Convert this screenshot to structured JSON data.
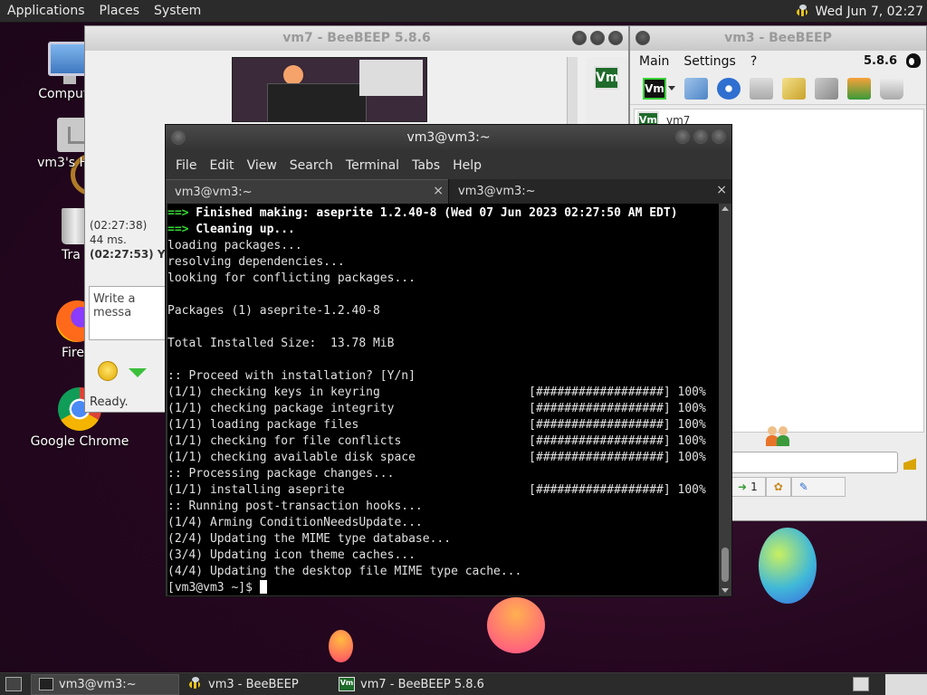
{
  "top_panel": {
    "menus": [
      "Applications",
      "Places",
      "System"
    ],
    "clock": "Wed Jun  7, 02:27"
  },
  "desktop_icons": [
    {
      "label": "Computer"
    },
    {
      "label": "vm3's Home"
    },
    {
      "label": "Tra"
    },
    {
      "label": "Fire"
    },
    {
      "label": "Google Chrome"
    }
  ],
  "beebeep_vm7": {
    "title": "vm7 - BeeBEEP 5.8.6",
    "chat_lines": [
      "(02:27:38)",
      "44 ms.",
      "(02:27:53) You"
    ],
    "input_placeholder": "Write a messa",
    "status": "Ready."
  },
  "beebeep_vm3": {
    "title": "vm3 - BeeBEEP",
    "menus": [
      "Main",
      "Settings",
      "?"
    ],
    "version": "5.8.6",
    "logo_text": "Vm",
    "user": "vm7",
    "bottom_count": "1"
  },
  "terminal": {
    "title": "vm3@vm3:~",
    "menus": [
      "File",
      "Edit",
      "View",
      "Search",
      "Terminal",
      "Tabs",
      "Help"
    ],
    "tabs": [
      {
        "label": "vm3@vm3:~",
        "close": "×"
      },
      {
        "label": "vm3@vm3:~",
        "close": "×"
      }
    ],
    "lines": [
      {
        "prefix": "==>",
        "text": " Finished making: aseprite 1.2.40-8 (Wed 07 Jun 2023 02:27:50 AM EDT)",
        "style": "bold"
      },
      {
        "prefix": "==>",
        "text": " Cleaning up...",
        "style": "bold"
      },
      {
        "prefix": "",
        "text": "loading packages...",
        "style": ""
      },
      {
        "prefix": "",
        "text": "resolving dependencies...",
        "style": ""
      },
      {
        "prefix": "",
        "text": "looking for conflicting packages...",
        "style": ""
      },
      {
        "prefix": "",
        "text": "",
        "style": ""
      },
      {
        "prefix": "",
        "text": "Packages (1) aseprite-1.2.40-8",
        "style": ""
      },
      {
        "prefix": "",
        "text": "",
        "style": ""
      },
      {
        "prefix": "",
        "text": "Total Installed Size:  13.78 MiB",
        "style": ""
      },
      {
        "prefix": "",
        "text": "",
        "style": ""
      },
      {
        "prefix": "",
        "text": ":: Proceed with installation? [Y/n]",
        "style": ""
      },
      {
        "prefix": "",
        "text": "(1/1) checking keys in keyring                     [##################] 100%",
        "style": ""
      },
      {
        "prefix": "",
        "text": "(1/1) checking package integrity                   [##################] 100%",
        "style": ""
      },
      {
        "prefix": "",
        "text": "(1/1) loading package files                        [##################] 100%",
        "style": ""
      },
      {
        "prefix": "",
        "text": "(1/1) checking for file conflicts                  [##################] 100%",
        "style": ""
      },
      {
        "prefix": "",
        "text": "(1/1) checking available disk space                [##################] 100%",
        "style": ""
      },
      {
        "prefix": "",
        "text": ":: Processing package changes...",
        "style": ""
      },
      {
        "prefix": "",
        "text": "(1/1) installing aseprite                          [##################] 100%",
        "style": ""
      },
      {
        "prefix": "",
        "text": ":: Running post-transaction hooks...",
        "style": ""
      },
      {
        "prefix": "",
        "text": "(1/4) Arming ConditionNeedsUpdate...",
        "style": ""
      },
      {
        "prefix": "",
        "text": "(2/4) Updating the MIME type database...",
        "style": ""
      },
      {
        "prefix": "",
        "text": "(3/4) Updating icon theme caches...",
        "style": ""
      },
      {
        "prefix": "",
        "text": "(4/4) Updating the desktop file MIME type cache...",
        "style": ""
      }
    ],
    "prompt": "[vm3@vm3 ~]$ "
  },
  "taskbar": {
    "tasks": [
      {
        "label": "vm3@vm3:~",
        "active": true
      },
      {
        "label": "vm3 - BeeBEEP",
        "active": false
      },
      {
        "label": "vm7 - BeeBEEP 5.8.6",
        "active": false
      }
    ]
  },
  "colors": {
    "terminal_highlight": "#35d935",
    "beebeep_logo": "#1f6b2b"
  }
}
